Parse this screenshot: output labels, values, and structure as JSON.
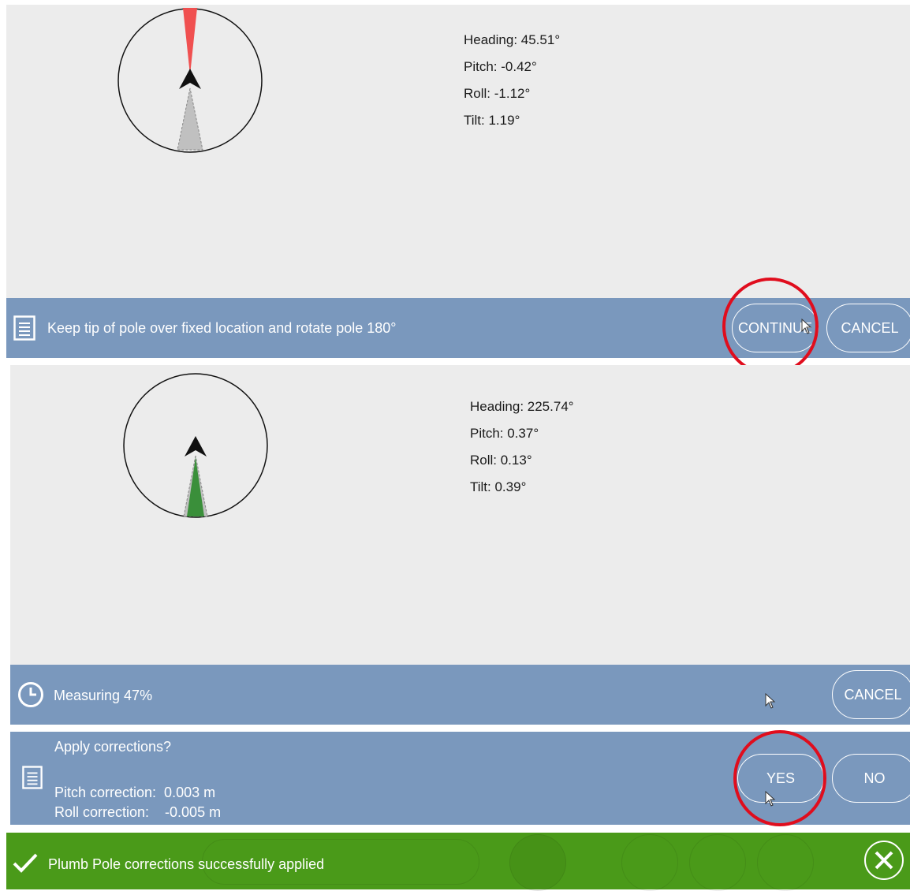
{
  "panel1": {
    "heading": "Heading:  45.51°",
    "pitch": "Pitch:  -0.42°",
    "roll": "Roll:  -1.12°",
    "tilt": "Tilt:  1.19°"
  },
  "instruction_bar": {
    "text": "Keep tip of pole over fixed location and rotate pole 180°",
    "continue_label": "CONTINUE",
    "cancel_label": "CANCEL"
  },
  "panel2": {
    "heading": "Heading:  225.74°",
    "pitch": "Pitch:  0.37°",
    "roll": "Roll:  0.13°",
    "tilt": "Tilt:  0.39°"
  },
  "measuring_bar": {
    "text": "Measuring 47%",
    "progress_percent": 47,
    "cancel_label": "CANCEL"
  },
  "corrections_bar": {
    "question": "Apply corrections?",
    "pitch_correction": "Pitch correction:  0.003 m",
    "roll_correction": "Roll correction:    -0.005 m",
    "yes_label": "YES",
    "no_label": "NO"
  },
  "success_bar": {
    "text": "Plumb Pole corrections successfully applied"
  },
  "icons": {
    "instruction": "document-icon",
    "measuring": "clock-icon",
    "corrections": "document-icon",
    "success": "checkmark-icon",
    "close": "close-icon"
  },
  "colors": {
    "bar_blue": "#7a98bd",
    "success_green": "#4a9a19",
    "highlight_red": "#e00d1d",
    "heading_red": "#f05050",
    "heading_green": "#3a8f3a"
  }
}
